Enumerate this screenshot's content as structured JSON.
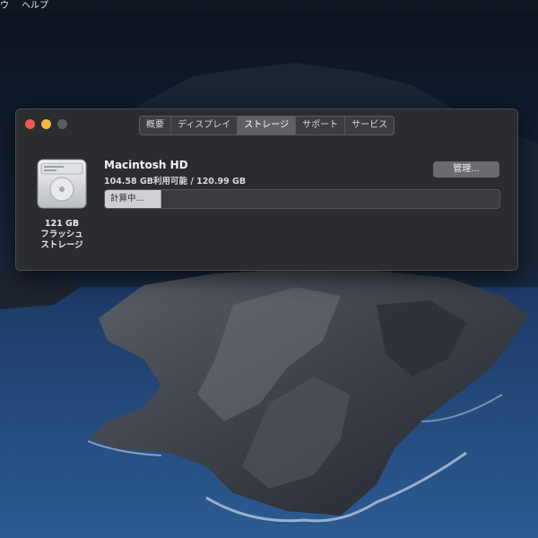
{
  "menubar": {
    "items": [
      "ウ",
      "ヘルプ"
    ]
  },
  "window": {
    "tabs": [
      {
        "label": "概要",
        "active": false
      },
      {
        "label": "ディスプレイ",
        "active": false
      },
      {
        "label": "ストレージ",
        "active": true
      },
      {
        "label": "サポート",
        "active": false
      },
      {
        "label": "サービス",
        "active": false
      }
    ],
    "drive": {
      "icon": "internal-drive-icon",
      "capacity": "121 GB",
      "type_line1": "フラッシュ",
      "type_line2": "ストレージ"
    },
    "volume": {
      "name": "Macintosh HD",
      "info": "104.58 GB利用可能 / 120.99 GB",
      "manage_label": "管理...",
      "bar_label": "計算中...",
      "bar_fill_fraction": 0.14
    }
  },
  "colors": {
    "window_bg": "#2b2c2f",
    "close": "#ee5a52",
    "minimize": "#f5b83e",
    "tab_active": "#606166"
  }
}
